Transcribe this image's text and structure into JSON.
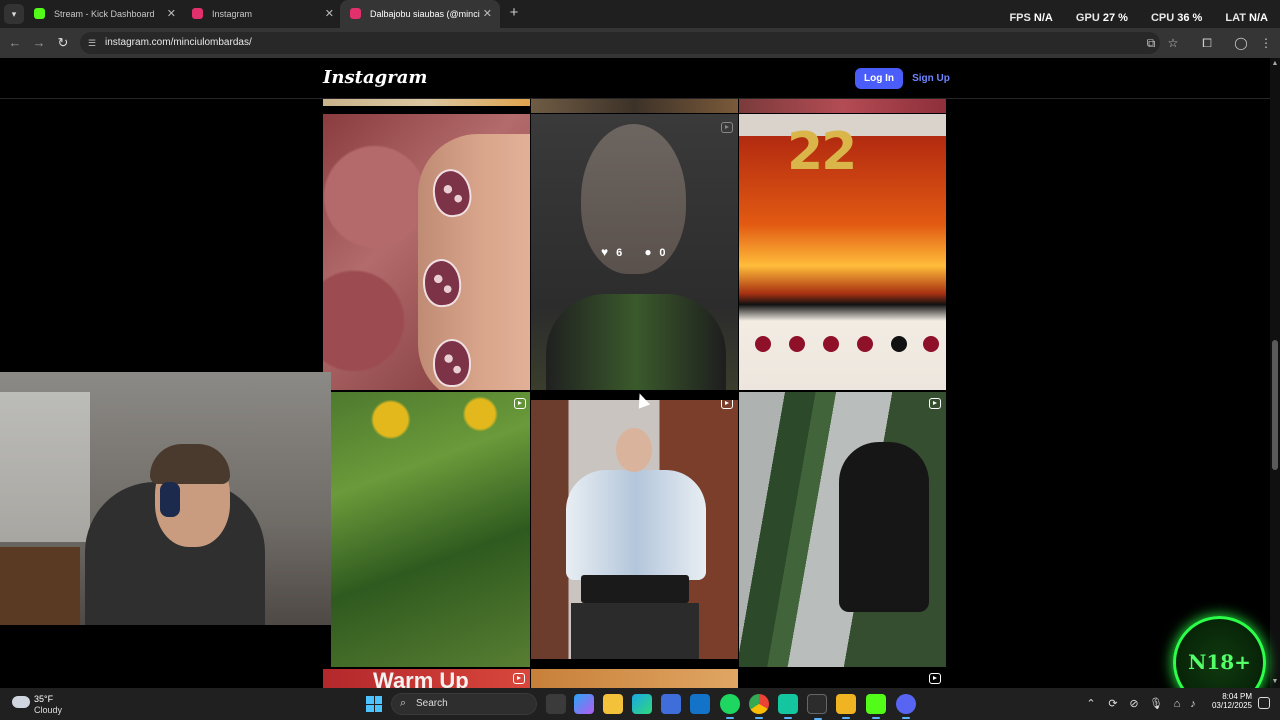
{
  "browser": {
    "tabs": [
      {
        "title": "Stream - Kick Dashboard",
        "favicon_color": "#53fc18"
      },
      {
        "title": "Instagram",
        "favicon_color": "#e1306c"
      },
      {
        "title": "Dalbajobu siaubas (@minciulom",
        "favicon_color": "#e1306c"
      }
    ],
    "url": "instagram.com/minciulombardas/",
    "overlay": {
      "fps_label": "FPS",
      "fps_value": "N/A",
      "gpu_label": "GPU",
      "gpu_value": "27 %",
      "cpu_label": "CPU",
      "cpu_value": "36 %",
      "lat_label": "LAT",
      "lat_value": "N/A"
    }
  },
  "instagram": {
    "logo": "Instagram",
    "login_label": "Log In",
    "signup_label": "Sign Up",
    "accent": "#4a5df9",
    "hovered_post": {
      "likes": "6",
      "comments": "0"
    },
    "tile_caption": "Warm Up",
    "cake_number": "22"
  },
  "badge": {
    "label": "N18+",
    "color": "#2bff4a"
  },
  "taskbar": {
    "weather_temp": "35°F",
    "weather_desc": "Cloudy",
    "search_label": "Search",
    "time": "8:04 PM",
    "date": "03/12/2025"
  }
}
